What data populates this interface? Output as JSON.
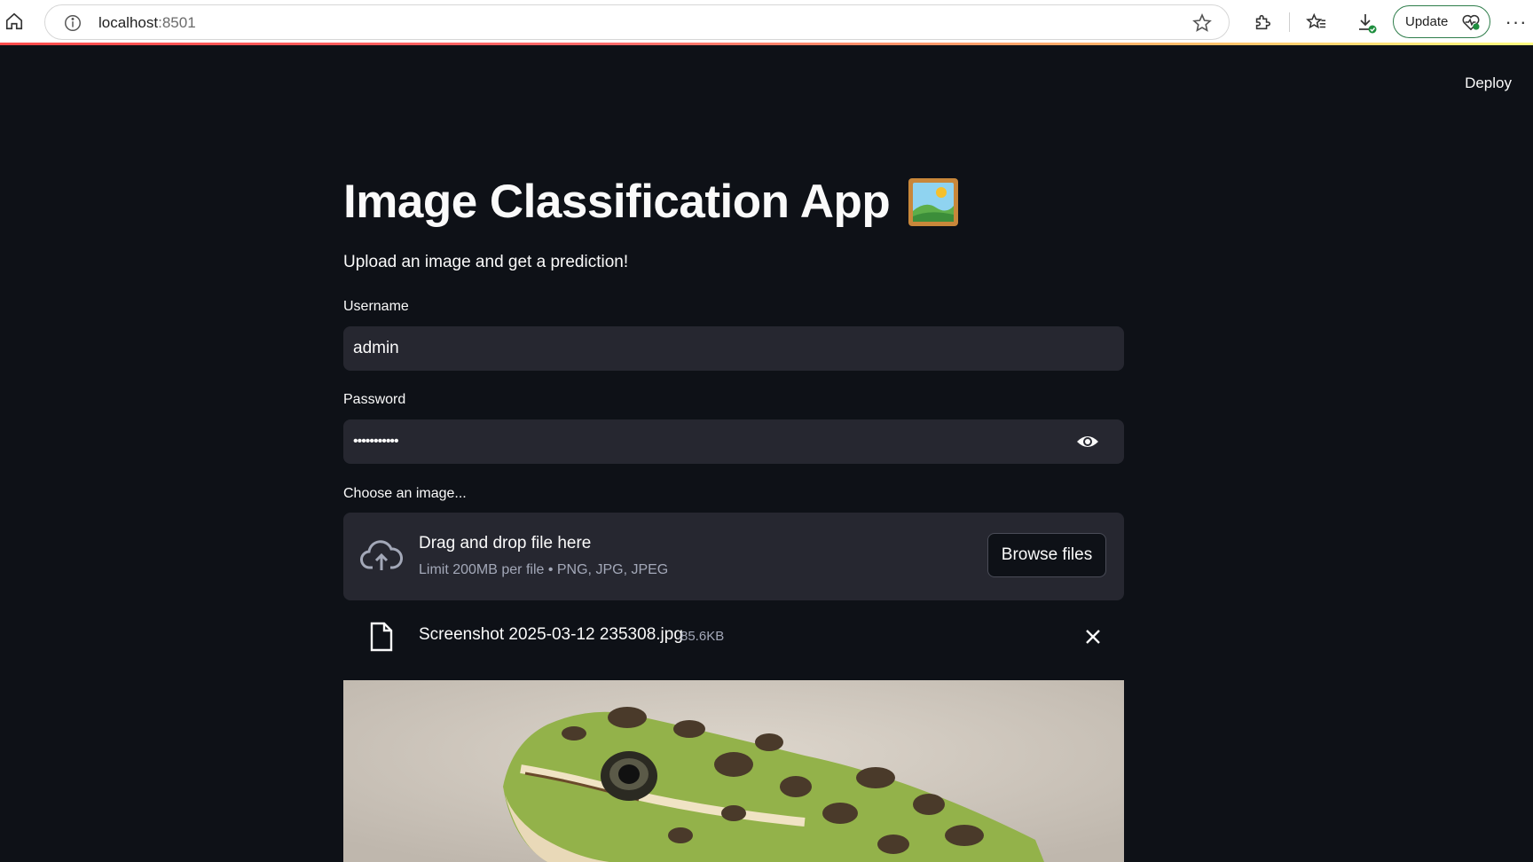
{
  "browser": {
    "url_host": "localhost",
    "url_port": ":8501",
    "update_label": "Update",
    "more_label": "···"
  },
  "app": {
    "deploy_label": "Deploy",
    "title": "Image Classification App",
    "title_emoji": "framed-picture",
    "subtitle": "Upload an image and get a prediction!"
  },
  "form": {
    "username_label": "Username",
    "username_value": "admin",
    "password_label": "Password",
    "password_value": "•••••••••••",
    "uploader_label": "Choose an image...",
    "dropzone_title": "Drag and drop file here",
    "dropzone_limit": "Limit 200MB per file • PNG, JPG, JPEG",
    "browse_label": "Browse files"
  },
  "uploaded_file": {
    "name": "Screenshot 2025-03-12 235308.jpg",
    "size": "85.6KB"
  },
  "colors": {
    "background": "#0e1117",
    "input_bg": "#262730",
    "text": "#fafafa",
    "accent_gradient_start": "#ff4b4b",
    "accent_gradient_end": "#fffd80"
  },
  "icons": {
    "home": "home-icon",
    "info": "info-icon",
    "star": "star-icon",
    "extensions": "puzzle-icon",
    "favorites": "favorites-icon",
    "downloads": "download-icon",
    "eye": "eye-icon",
    "upload": "cloud-upload-icon",
    "file": "file-icon",
    "close": "close-icon"
  }
}
